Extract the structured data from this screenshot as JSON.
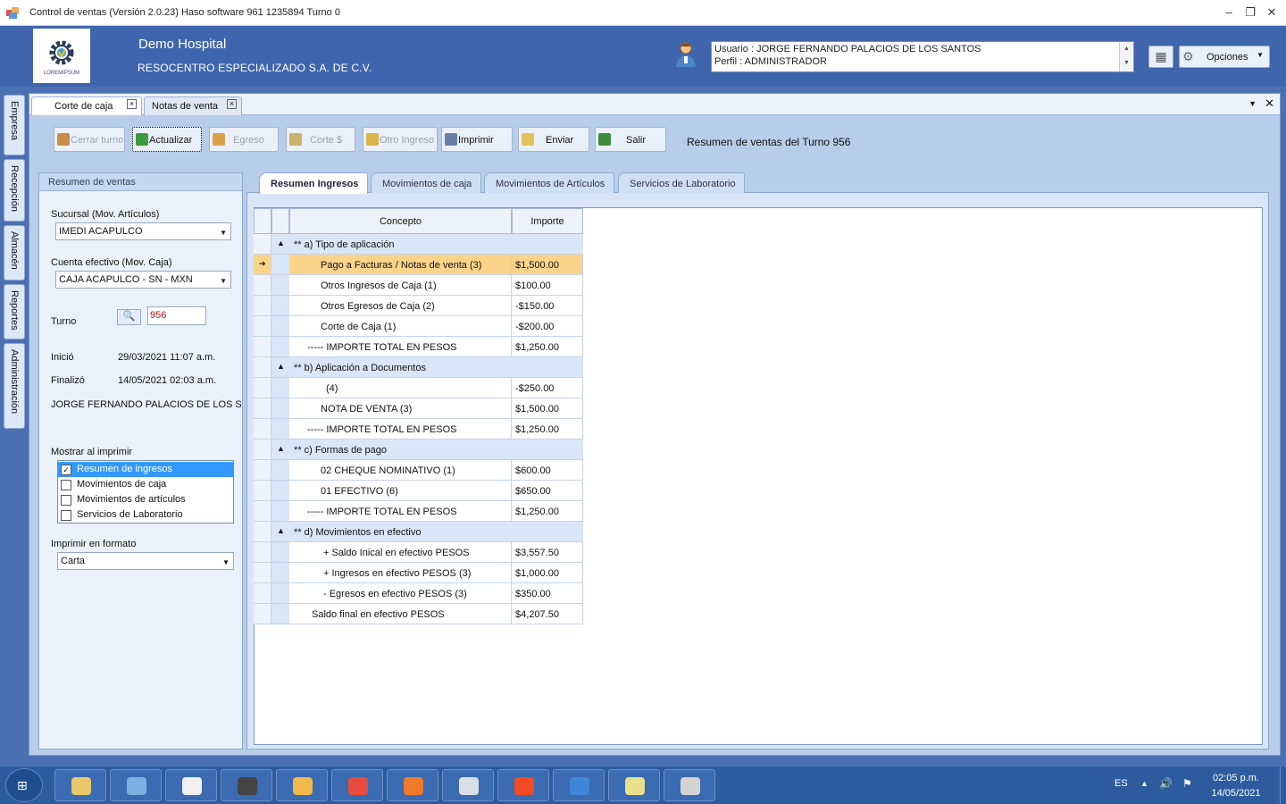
{
  "window": {
    "title": "Control de ventas  (Versión 2.0.23)  Haso software  961 1235894  Turno 0",
    "minimize": "‒",
    "maximize": "❐",
    "close": "✕"
  },
  "header": {
    "logo_text": "LOREMIPSUM",
    "org_name": "Demo Hospital",
    "org_legal": "RESOCENTRO ESPECIALIZADO S.A. DE C.V.",
    "user_line": "Usuario : JORGE FERNANDO PALACIOS DE LOS SANTOS",
    "profile_line": "Perfil : ADMINISTRADOR",
    "options_label": "Opciones"
  },
  "side_tabs": [
    "Empresa",
    "Recepción",
    "Almacén",
    "Reportes",
    "Administración"
  ],
  "doc_tabs": [
    {
      "label": "Corte de caja",
      "active": true
    },
    {
      "label": "Notas de venta",
      "active": false
    }
  ],
  "toolbar": {
    "buttons": [
      {
        "label": "Cerrar turno",
        "enabled": false,
        "icon": "lock-icon",
        "color": "#c98d4a"
      },
      {
        "label": "Actualizar",
        "enabled": true,
        "icon": "refresh-icon",
        "color": "#3e9a3e"
      },
      {
        "label": "Egreso",
        "enabled": false,
        "icon": "coins-out-icon",
        "color": "#d9a24a"
      },
      {
        "label": "Corte $",
        "enabled": false,
        "icon": "cash-cut-icon",
        "color": "#c9b46a"
      },
      {
        "label": "Otro Ingreso",
        "enabled": false,
        "icon": "coins-in-icon",
        "color": "#d8b54a"
      },
      {
        "label": "Imprimir",
        "enabled": true,
        "icon": "printer-icon",
        "color": "#6b7fa5"
      },
      {
        "label": "Enviar",
        "enabled": true,
        "icon": "envelope-icon",
        "color": "#e3c25a"
      },
      {
        "label": "Salir",
        "enabled": true,
        "icon": "exit-icon",
        "color": "#3e8a3e"
      }
    ],
    "title": "Resumen de ventas del Turno 956"
  },
  "left_panel": {
    "header": "Resumen de ventas",
    "sucursal_label": "Sucursal (Mov. Artículos)",
    "sucursal_value": "IMEDI ACAPULCO",
    "cuenta_label": "Cuenta efectivo (Mov. Caja)",
    "cuenta_value": "CAJA ACAPULCO - SN - MXN",
    "turno_label": "Turno",
    "turno_value": "956",
    "inicio_label": "Inició",
    "inicio_value": "29/03/2021 11:07 a.m.",
    "finalizo_label": "Finalizó",
    "finalizo_value": "14/05/2021 02:03 a.m.",
    "cajero": "JORGE FERNANDO PALACIOS DE LOS SANTOS",
    "mostrar_label": "Mostrar al imprimir",
    "print_options": [
      {
        "label": "Resumen de ingresos",
        "checked": true,
        "selected": true
      },
      {
        "label": "Movimientos de caja",
        "checked": false,
        "selected": false
      },
      {
        "label": "Movimientos de artículos",
        "checked": false,
        "selected": false
      },
      {
        "label": "Servicios de Laboratorio",
        "checked": false,
        "selected": false
      }
    ],
    "formato_label": "Imprimir en formato",
    "formato_value": "Carta"
  },
  "inner_tabs": [
    "Resumen  Ingresos",
    "Movimientos de caja",
    "Movimientos de Artículos",
    "Servicios de Laboratorio"
  ],
  "grid": {
    "columns": [
      "Concepto",
      "Importe"
    ],
    "rows": [
      {
        "type": "group",
        "concepto": "**  a) Tipo de aplicación",
        "importe": ""
      },
      {
        "type": "item",
        "indent": 2,
        "concepto": "Pago a  Facturas / Notas de venta  (3)",
        "importe": "$1,500.00",
        "highlight": true
      },
      {
        "type": "item",
        "indent": 2,
        "concepto": "Otros Ingresos de Caja  (1)",
        "importe": "$100.00"
      },
      {
        "type": "item",
        "indent": 2,
        "concepto": "Otros Egresos de Caja  (2)",
        "importe": "-$150.00"
      },
      {
        "type": "item",
        "indent": 2,
        "concepto": "Corte de Caja  (1)",
        "importe": "-$200.00"
      },
      {
        "type": "item",
        "indent": 1,
        "concepto": "-----  IMPORTE TOTAL  EN  PESOS",
        "importe": "$1,250.00"
      },
      {
        "type": "group",
        "concepto": "**  b) Aplicación a Documentos",
        "importe": ""
      },
      {
        "type": "item",
        "indent": 3,
        "concepto": "(4)",
        "importe": "-$250.00"
      },
      {
        "type": "item",
        "indent": 2,
        "concepto": "NOTA DE VENTA  (3)",
        "importe": "$1,500.00"
      },
      {
        "type": "item",
        "indent": 1,
        "concepto": "-----  IMPORTE TOTAL  EN  PESOS",
        "importe": "$1,250.00"
      },
      {
        "type": "group",
        "concepto": "**  c) Formas de pago",
        "importe": ""
      },
      {
        "type": "item",
        "indent": 2,
        "concepto": "02 CHEQUE NOMINATIVO (1)",
        "importe": "$600.00"
      },
      {
        "type": "item",
        "indent": 2,
        "concepto": "01 EFECTIVO (6)",
        "importe": "$650.00"
      },
      {
        "type": "item",
        "indent": 1,
        "concepto": "-----  IMPORTE TOTAL  EN  PESOS",
        "importe": "$1,250.00"
      },
      {
        "type": "group",
        "concepto": "**  d) Movimientos en efectivo",
        "importe": ""
      },
      {
        "type": "item",
        "indent": 4,
        "concepto": "+ Saldo Inical en efectivo PESOS",
        "importe": "$3,557.50"
      },
      {
        "type": "item",
        "indent": 4,
        "concepto": "+ Ingresos en efectivo PESOS (3)",
        "importe": "$1,000.00"
      },
      {
        "type": "item",
        "indent": 4,
        "concepto": "- Egresos en efectivo PESOS (3)",
        "importe": "$350.00"
      },
      {
        "type": "item",
        "indent": 5,
        "concepto": "Saldo final en efectivo PESOS",
        "importe": "$4,207.50"
      }
    ]
  },
  "taskbar": {
    "apps": [
      {
        "name": "explorer-icon",
        "color": "#e9c86a"
      },
      {
        "name": "paint-icon",
        "color": "#7bb0e0"
      },
      {
        "name": "media-player-icon",
        "color": "#f0f0f0"
      },
      {
        "name": "sublime-icon",
        "color": "#444444"
      },
      {
        "name": "user-app-icon",
        "color": "#f2b84a"
      },
      {
        "name": "chrome-icon",
        "color": "#e94b3c"
      },
      {
        "name": "firefox-icon",
        "color": "#f07a2a"
      },
      {
        "name": "tool-icon",
        "color": "#d9dde4"
      },
      {
        "name": "brave-icon",
        "color": "#f24b22"
      },
      {
        "name": "network-app-icon",
        "color": "#3f86d8"
      },
      {
        "name": "sticky-notes-icon",
        "color": "#e8e08a"
      },
      {
        "name": "control-ventas-icon",
        "color": "#d3d3d3"
      }
    ],
    "lang": "ES",
    "time": "02:05 p.m.",
    "date": "14/05/2021"
  }
}
